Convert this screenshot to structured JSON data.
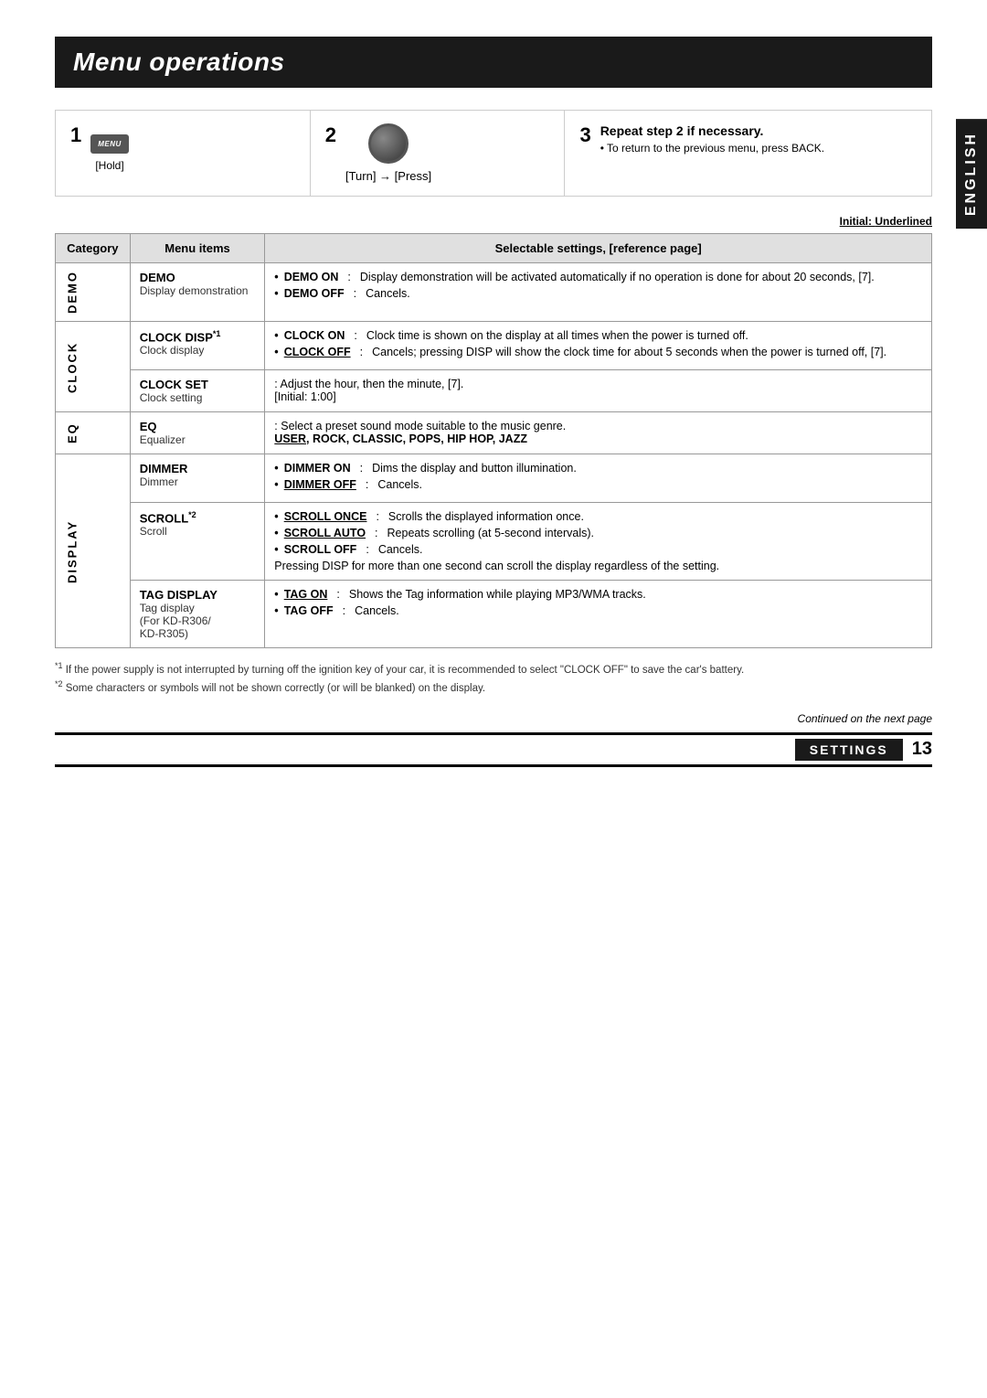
{
  "page": {
    "title": "Menu operations",
    "english_label": "ENGLISH",
    "initial_note": "Initial: ",
    "initial_value": "Underlined",
    "continued": "Continued on the next page",
    "footer_label": "SETTINGS",
    "footer_page": "13"
  },
  "steps": [
    {
      "number": "1",
      "icon": "menu-button",
      "label": "MENU",
      "hold": "[Hold]"
    },
    {
      "number": "2",
      "icon": "knob",
      "instruction": "[Turn] → [Press]"
    },
    {
      "number": "3",
      "title": "Repeat step 2 if necessary.",
      "desc": "• To return to the previous menu, press BACK."
    }
  ],
  "table": {
    "headers": [
      "Category",
      "Menu items",
      "Selectable settings, [reference page]"
    ],
    "rows": [
      {
        "category": "DEMO",
        "category_span": 2,
        "items": [
          {
            "name": "DEMO",
            "name_suffix": "",
            "desc": "Display demonstration",
            "settings": [
              {
                "key": "DEMO ON",
                "underline": true,
                "value": "Display demonstration will be activated automatically if no operation is done for about 20 seconds, [7]."
              },
              {
                "key": "DEMO OFF",
                "underline": false,
                "value": "Cancels."
              }
            ]
          }
        ]
      },
      {
        "category": "CLOCK",
        "category_span": 3,
        "items": [
          {
            "name": "CLOCK DISP",
            "name_suffix": "*1",
            "desc": "Clock display",
            "settings": [
              {
                "key": "CLOCK ON",
                "underline": false,
                "value": "Clock time is shown on the display at all times when the power is turned off."
              },
              {
                "key": "CLOCK OFF",
                "underline": true,
                "value": "Cancels; pressing DISP will show the clock time for about 5 seconds when the power is turned off, [7]."
              }
            ]
          },
          {
            "name": "CLOCK SET",
            "name_suffix": "",
            "desc": "Clock setting",
            "settings_text": ": Adjust the hour, then the minute, [7].\n[Initial: 1:00]"
          }
        ]
      },
      {
        "category": "EQ",
        "category_span": 1,
        "items": [
          {
            "name": "EQ",
            "name_suffix": "",
            "desc": "Equalizer",
            "settings_eq": ": Select a preset sound mode suitable to the music genre.\nUSER, ROCK, CLASSIC, POPS, HIP HOP, JAZZ"
          }
        ]
      },
      {
        "category": "DISPLAY",
        "category_span": 3,
        "items": [
          {
            "name": "DIMMER",
            "name_suffix": "",
            "desc": "Dimmer",
            "settings": [
              {
                "key": "DIMMER ON",
                "underline": false,
                "value": "Dims the display and button illumination."
              },
              {
                "key": "DIMMER OFF",
                "underline": true,
                "value": "Cancels."
              }
            ]
          },
          {
            "name": "SCROLL",
            "name_suffix": "*2",
            "desc": "Scroll",
            "settings": [
              {
                "key": "SCROLL ONCE",
                "underline": true,
                "value": "Scrolls the displayed information once."
              },
              {
                "key": "SCROLL AUTO",
                "underline": false,
                "value": "Repeats scrolling (at 5-second intervals)."
              },
              {
                "key": "SCROLL OFF",
                "underline": false,
                "value": "Cancels."
              }
            ],
            "settings_extra": "Pressing DISP for more than one second can scroll the display regardless of the setting."
          },
          {
            "name": "TAG DISPLAY",
            "name_suffix": "",
            "desc": "Tag display\n(For KD-R306/\nKD-R305)",
            "settings": [
              {
                "key": "TAG ON",
                "underline": true,
                "value": "Shows the Tag information while playing MP3/WMA tracks."
              },
              {
                "key": "TAG OFF",
                "underline": false,
                "value": "Cancels."
              }
            ]
          }
        ]
      }
    ]
  },
  "footnotes": [
    {
      "marker": "*1",
      "text": "If the power supply is not interrupted by turning off the ignition key of your car, it is recommended to select \"CLOCK OFF\" to save the car's battery."
    },
    {
      "marker": "*2",
      "text": "Some characters or symbols will not be shown correctly (or will be blanked) on the display."
    }
  ]
}
